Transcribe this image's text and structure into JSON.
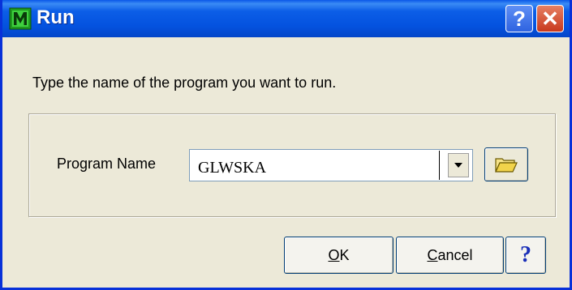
{
  "window": {
    "title": "Run",
    "app_icon": "m-letter-icon",
    "help_label": "?",
    "close_label": "✕",
    "colors": {
      "titlebar": "#0c5ee7",
      "close": "#c8391d",
      "face": "#ece9d8"
    }
  },
  "instruction": "Type the name of the program you want to run.",
  "program": {
    "label": "Program Name",
    "value": "GLWSKA",
    "browse_icon": "folder-open-icon"
  },
  "buttons": {
    "ok_mnemonic": "O",
    "ok_rest": "K",
    "cancel_mnemonic": "C",
    "cancel_rest": "ancel",
    "help": "?"
  }
}
